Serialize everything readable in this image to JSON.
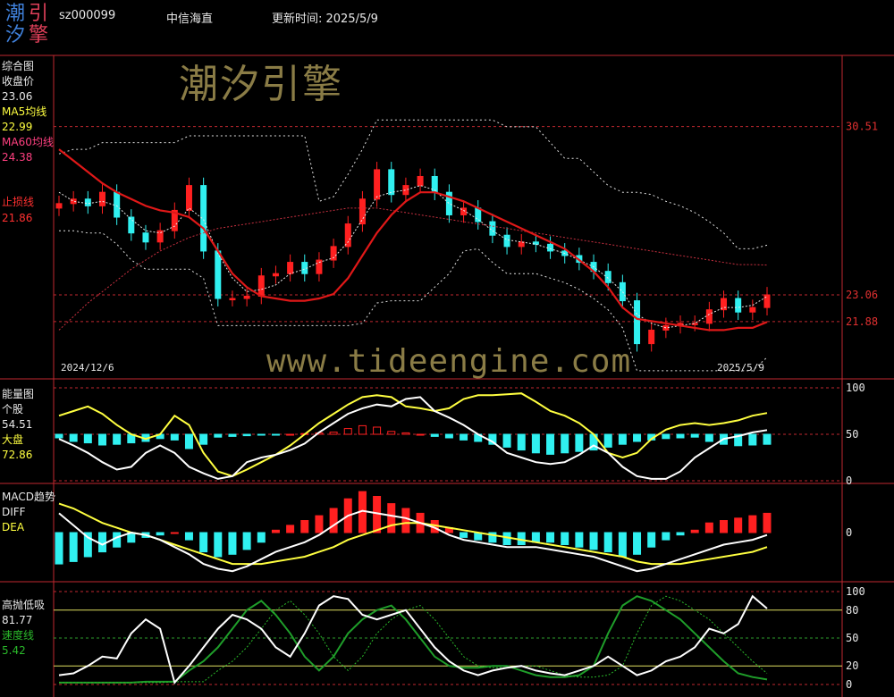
{
  "header": {
    "logo_chars": [
      "潮",
      "引",
      "汐",
      "擎"
    ],
    "stock_code": "sz000099",
    "stock_name": "中信海直",
    "update_time": "更新时间: 2025/5/9"
  },
  "watermarks": {
    "brand": "潮汐引擎",
    "url": "www.tideengine.com"
  },
  "colors": {
    "background": "#000000",
    "grid_red": "#c0282f",
    "up": "#ff2020",
    "down": "#30f0f0",
    "ma5": "#ffff40",
    "ma60": "#ff4040",
    "white": "#ffffff",
    "green": "#1f9e2a",
    "axis_text": "#e03030"
  },
  "panels": {
    "main": {
      "title": "综合图",
      "items": [
        {
          "label": "收盘价",
          "value": "23.06",
          "color": "#ffffff"
        },
        {
          "label": "MA5均线",
          "value": "22.99",
          "color": "#ffff40"
        },
        {
          "label": "MA60均线",
          "value": "24.38",
          "color": "#ff4080"
        },
        {
          "label": "止损线",
          "value": "21.86",
          "color": "#ff3030"
        }
      ],
      "right_labels": [
        "30.51",
        "23.06",
        "21.88"
      ],
      "date_start": "2024/12/6",
      "date_end": "2025/5/9"
    },
    "energy": {
      "title": "能量图",
      "items": [
        {
          "label": "个股",
          "value": "54.51",
          "color": "#ffffff"
        },
        {
          "label": "大盘",
          "value": "72.86",
          "color": "#ffff40"
        }
      ],
      "right_labels": [
        "100",
        "50",
        "0"
      ]
    },
    "macd": {
      "title": "MACD趋势",
      "items": [
        {
          "label": "DIFF",
          "value": "",
          "color": "#ffffff"
        },
        {
          "label": "DEA",
          "value": "",
          "color": "#ffff40"
        }
      ],
      "right_labels": [
        "0"
      ]
    },
    "sell": {
      "title": "高抛低吸",
      "items": [
        {
          "label": "",
          "value": "81.77",
          "color": "#ffffff"
        },
        {
          "label": "速度线",
          "value": "5.42",
          "color": "#2ab82a"
        }
      ],
      "right_labels": [
        "100",
        "80",
        "50",
        "20",
        "0"
      ]
    }
  },
  "chart_data": [
    {
      "type": "line",
      "panel": "main",
      "title": "综合图",
      "x_range": [
        "2024/12/6",
        "2025/5/9"
      ],
      "ylim": [
        19.5,
        33.5
      ],
      "reference_lines": [
        30.51,
        21.88
      ],
      "series": [
        {
          "name": "收盘价",
          "values": [
            27.1,
            27.3,
            27.0,
            27.6,
            26.5,
            25.8,
            25.4,
            25.9,
            26.8,
            27.9,
            25.0,
            22.9,
            22.9,
            23.0,
            23.9,
            24.0,
            24.5,
            24.0,
            24.6,
            25.2,
            26.2,
            27.3,
            28.6,
            27.5,
            27.9,
            28.3,
            27.6,
            26.6,
            26.9,
            26.3,
            25.7,
            25.2,
            25.4,
            25.3,
            25.0,
            24.8,
            24.5,
            24.1,
            23.6,
            22.8,
            20.9,
            21.5,
            21.7,
            21.8,
            21.8,
            22.4,
            22.9,
            22.3,
            22.5,
            23.06
          ]
        },
        {
          "name": "MA5均线",
          "values": [
            27.6,
            27.2,
            27.1,
            27.2,
            27.0,
            26.4,
            25.9,
            25.8,
            26.1,
            26.9,
            26.4,
            24.9,
            23.8,
            23.2,
            23.3,
            23.5,
            24.0,
            24.2,
            24.5,
            24.7,
            25.4,
            26.4,
            27.4,
            27.6,
            27.7,
            27.9,
            27.7,
            27.1,
            26.8,
            26.4,
            25.9,
            25.5,
            25.4,
            25.3,
            25.1,
            24.9,
            24.6,
            24.3,
            23.8,
            23.2,
            22.2,
            21.8,
            21.6,
            21.7,
            21.8,
            22.2,
            22.5,
            22.5,
            22.6,
            22.99
          ]
        },
        {
          "name": "MA60均线",
          "values": [
            21.5,
            22.1,
            22.7,
            23.2,
            23.7,
            24.2,
            24.6,
            25.0,
            25.3,
            25.6,
            25.8,
            26.0,
            26.1,
            26.2,
            26.3,
            26.4,
            26.5,
            26.6,
            26.7,
            26.8,
            26.9,
            26.9,
            26.9,
            26.8,
            26.7,
            26.6,
            26.5,
            26.4,
            26.3,
            26.2,
            26.1,
            26.0,
            25.9,
            25.8,
            25.7,
            25.6,
            25.5,
            25.4,
            25.3,
            25.2,
            25.1,
            25.0,
            24.9,
            24.8,
            24.7,
            24.6,
            24.5,
            24.4,
            24.4,
            24.38
          ]
        },
        {
          "name": "止损线",
          "values": [
            29.5,
            29.0,
            28.5,
            28.0,
            27.6,
            27.3,
            27.0,
            26.8,
            26.7,
            26.5,
            26.0,
            25.0,
            24.0,
            23.4,
            23.0,
            22.9,
            22.8,
            22.8,
            22.9,
            23.1,
            23.8,
            24.8,
            25.8,
            26.6,
            27.2,
            27.6,
            27.6,
            27.4,
            27.2,
            26.9,
            26.6,
            26.3,
            26.0,
            25.7,
            25.4,
            25.1,
            24.6,
            24.1,
            23.4,
            22.5,
            22.0,
            21.9,
            21.8,
            21.7,
            21.6,
            21.5,
            21.5,
            21.6,
            21.6,
            21.86
          ]
        }
      ]
    },
    {
      "type": "line",
      "panel": "energy",
      "title": "能量图",
      "ylim": [
        0,
        100
      ],
      "series": [
        {
          "name": "个股",
          "values": [
            45,
            38,
            30,
            20,
            12,
            15,
            30,
            38,
            30,
            15,
            8,
            2,
            5,
            20,
            25,
            28,
            33,
            40,
            52,
            62,
            72,
            78,
            82,
            80,
            88,
            90,
            75,
            68,
            60,
            50,
            42,
            30,
            25,
            20,
            18,
            20,
            28,
            38,
            30,
            15,
            5,
            2,
            2,
            10,
            25,
            35,
            45,
            48,
            52,
            54.51
          ]
        },
        {
          "name": "大盘",
          "values": [
            70,
            75,
            80,
            72,
            60,
            50,
            45,
            50,
            70,
            60,
            30,
            10,
            5,
            12,
            20,
            28,
            38,
            50,
            62,
            72,
            82,
            90,
            92,
            90,
            80,
            78,
            75,
            78,
            88,
            92,
            92,
            93,
            94,
            85,
            75,
            70,
            62,
            50,
            30,
            25,
            30,
            45,
            55,
            60,
            62,
            60,
            62,
            65,
            70,
            72.86
          ]
        }
      ]
    },
    {
      "type": "bar",
      "panel": "energy",
      "name": "能量柱",
      "values": [
        -5,
        -10,
        -12,
        -15,
        -14,
        -12,
        -10,
        -6,
        -8,
        -20,
        -14,
        -4,
        -3,
        -2,
        -1,
        -1,
        0,
        1,
        2,
        3,
        8,
        12,
        10,
        4,
        2,
        0,
        -3,
        -5,
        -8,
        -10,
        -14,
        -18,
        -22,
        -26,
        -28,
        -26,
        -24,
        -22,
        -18,
        -14,
        -10,
        -8,
        -6,
        -5,
        -4,
        -10,
        -14,
        -16,
        -15,
        -14
      ]
    },
    {
      "type": "bar",
      "panel": "macd",
      "name": "MACD柱",
      "values": [
        -1.3,
        -1.2,
        -1.0,
        -0.8,
        -0.6,
        -0.4,
        -0.2,
        -0.1,
        0.0,
        -0.3,
        -0.8,
        -1.0,
        -0.9,
        -0.7,
        -0.4,
        0.1,
        0.3,
        0.5,
        0.7,
        1.0,
        1.4,
        1.7,
        1.5,
        1.2,
        1.0,
        0.8,
        0.5,
        0.2,
        -0.2,
        -0.3,
        -0.4,
        -0.5,
        -0.5,
        -0.4,
        -0.4,
        -0.5,
        -0.6,
        -0.7,
        -0.8,
        -1.0,
        -0.9,
        -0.6,
        -0.3,
        -0.1,
        0.1,
        0.4,
        0.5,
        0.6,
        0.7,
        0.8
      ]
    },
    {
      "type": "line",
      "panel": "macd",
      "series": [
        {
          "name": "DIFF",
          "values": [
            0.8,
            0.3,
            -0.2,
            -0.5,
            -0.2,
            0.0,
            -0.1,
            -0.3,
            -0.6,
            -0.9,
            -1.3,
            -1.5,
            -1.6,
            -1.4,
            -1.1,
            -0.8,
            -0.6,
            -0.4,
            -0.1,
            0.3,
            0.7,
            0.9,
            0.8,
            0.7,
            0.6,
            0.4,
            0.2,
            -0.1,
            -0.3,
            -0.4,
            -0.5,
            -0.6,
            -0.6,
            -0.6,
            -0.7,
            -0.8,
            -0.9,
            -1.0,
            -1.2,
            -1.4,
            -1.6,
            -1.5,
            -1.3,
            -1.1,
            -0.9,
            -0.7,
            -0.5,
            -0.4,
            -0.3,
            -0.1
          ]
        },
        {
          "name": "DEA",
          "values": [
            1.2,
            1.0,
            0.7,
            0.4,
            0.2,
            0.0,
            -0.1,
            -0.3,
            -0.5,
            -0.7,
            -0.9,
            -1.1,
            -1.3,
            -1.3,
            -1.3,
            -1.2,
            -1.1,
            -1.0,
            -0.8,
            -0.6,
            -0.3,
            -0.1,
            0.1,
            0.3,
            0.4,
            0.4,
            0.3,
            0.2,
            0.1,
            0.0,
            -0.1,
            -0.2,
            -0.3,
            -0.4,
            -0.5,
            -0.6,
            -0.7,
            -0.8,
            -0.9,
            -1.0,
            -1.2,
            -1.3,
            -1.3,
            -1.3,
            -1.2,
            -1.1,
            -1.0,
            -0.9,
            -0.8,
            -0.6
          ]
        }
      ]
    },
    {
      "type": "line",
      "panel": "sell",
      "title": "高抛低吸",
      "ylim": [
        0,
        100
      ],
      "reference_lines": [
        80,
        50,
        20
      ],
      "series": [
        {
          "name": "高抛低吸",
          "values": [
            10,
            12,
            20,
            30,
            28,
            55,
            70,
            60,
            2,
            20,
            40,
            60,
            75,
            70,
            60,
            40,
            30,
            55,
            85,
            95,
            92,
            75,
            70,
            75,
            80,
            60,
            40,
            25,
            15,
            10,
            15,
            18,
            20,
            15,
            12,
            10,
            15,
            20,
            30,
            20,
            10,
            15,
            25,
            30,
            40,
            60,
            55,
            65,
            95,
            81.77
          ]
        },
        {
          "name": "速度线",
          "values": [
            2,
            2,
            2,
            2,
            2,
            2,
            3,
            3,
            3,
            15,
            25,
            40,
            60,
            80,
            90,
            75,
            55,
            30,
            15,
            30,
            55,
            70,
            80,
            85,
            70,
            50,
            30,
            20,
            18,
            18,
            20,
            20,
            15,
            10,
            8,
            8,
            10,
            20,
            55,
            85,
            95,
            90,
            80,
            70,
            55,
            40,
            25,
            12,
            8,
            5.42
          ]
        }
      ]
    }
  ]
}
